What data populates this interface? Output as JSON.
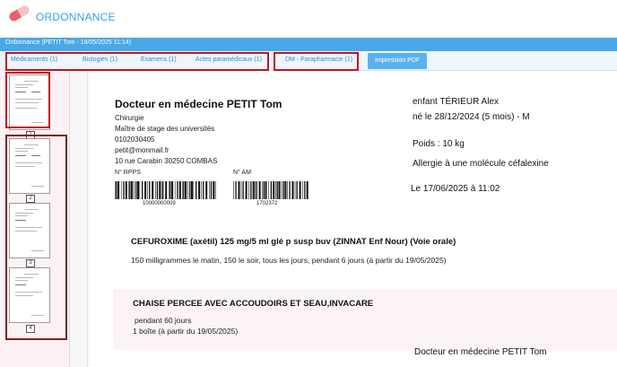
{
  "app": {
    "title": "ORDONNANCE",
    "brand_color": "#3aa0e0",
    "highlight_color": "#c0141d"
  },
  "window": {
    "title": "Ordonnance (PETIT Tom - 19/05/2025 11:14)"
  },
  "tabs": [
    {
      "label": "Médicaments (1)"
    },
    {
      "label": "Biologies (1)"
    },
    {
      "label": "Examens (1)"
    },
    {
      "label": "Actes paramédicaux (1)"
    },
    {
      "label": "DM - Parapharmacie (1)"
    },
    {
      "label": "Impression PDF",
      "active": true
    }
  ],
  "thumbnails": [
    {
      "number": "1"
    },
    {
      "number": "2"
    },
    {
      "number": "3"
    },
    {
      "number": "4"
    }
  ],
  "doctor": {
    "name": "Docteur en médecine PETIT Tom",
    "specialty": "Chirurgie",
    "role": "Maître de stage des universités",
    "phone": "0102030405",
    "email": "petit@monmail.fr",
    "address": "10 rue Carabin 30250 COMBAS",
    "rpps_label": "N° RPPS",
    "rpps_number": "10000000009",
    "am_label": "N° AM",
    "am_number": "1702372"
  },
  "patient": {
    "name": "enfant TÉRIEUR Alex",
    "birth": "né le 28/12/2024 (5 mois) - M",
    "weight": "Poids : 10 kg",
    "allergy": "Allergie à une molécule céfalexine"
  },
  "date_line": "Le 17/06/2025 à 11:02",
  "prescriptions": [
    {
      "title": "CEFUROXIME (axétil) 125 mg/5 ml glé p susp buv (ZINNAT Enf Nour) (Voie orale)",
      "lines": [
        "150 milligrammes le matin, 150 le soir, tous les jours, pendant 6 jours (à partir du 19/05/2025)"
      ]
    },
    {
      "title": "CHAISE PERCEE AVEC ACCOUDOIRS ET SEAU,INVACARE",
      "lines": [
        "pendant 60 jours",
        "1 boîte  (à partir du 19/05/2025)"
      ]
    }
  ],
  "signature": "Docteur en médecine PETIT Tom"
}
